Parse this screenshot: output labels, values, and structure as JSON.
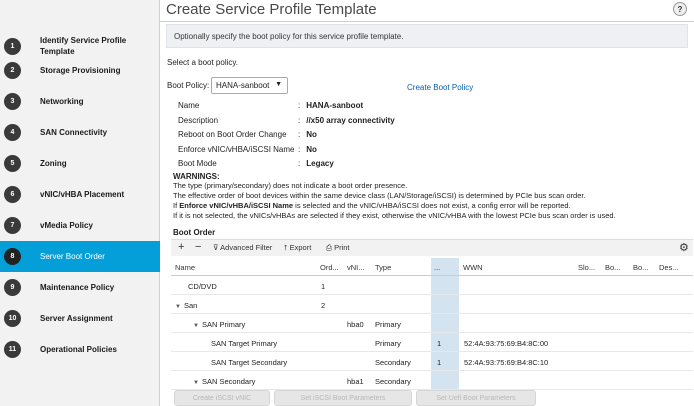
{
  "sidebar": {
    "items": [
      {
        "num": "1",
        "label": "Identify Service Profile Template"
      },
      {
        "num": "2",
        "label": "Storage Provisioning"
      },
      {
        "num": "3",
        "label": "Networking"
      },
      {
        "num": "4",
        "label": "SAN Connectivity"
      },
      {
        "num": "5",
        "label": "Zoning"
      },
      {
        "num": "6",
        "label": "vNIC/vHBA Placement"
      },
      {
        "num": "7",
        "label": "vMedia Policy"
      },
      {
        "num": "8",
        "label": "Server Boot Order"
      },
      {
        "num": "9",
        "label": "Maintenance Policy"
      },
      {
        "num": "10",
        "label": "Server Assignment"
      },
      {
        "num": "11",
        "label": "Operational Policies"
      }
    ],
    "active_index": 7
  },
  "header": {
    "title": "Create Service Profile Template",
    "help": "?"
  },
  "description": "Optionally specify the boot policy for this service profile template.",
  "select_text": "Select a boot policy.",
  "boot_policy": {
    "label": "Boot Policy:",
    "value": "HANA-sanboot",
    "create_link": "Create Boot Policy"
  },
  "properties": [
    {
      "name": "Name",
      "value": "HANA-sanboot"
    },
    {
      "name": "Description",
      "value": "//x50 array connectivity"
    },
    {
      "name": "Reboot on Boot Order Change",
      "value": "No"
    },
    {
      "name": "Enforce vNIC/vHBA/iSCSI Name",
      "value": "No"
    },
    {
      "name": "Boot Mode",
      "value": "Legacy"
    }
  ],
  "warnings": {
    "title": "WARNINGS:",
    "line1": "The type (primary/secondary) does not indicate a boot order presence.",
    "line2": "The effective order of boot devices within the same device class (LAN/Storage/iSCSI) is determined by PCIe bus scan order.",
    "line3_prefix": "If ",
    "line3_bold": "Enforce vNIC/vHBA/iSCSI Name",
    "line3_suffix": " is selected and the vNIC/vHBA/iSCSI does not exist, a config error will be reported.",
    "line4": "If it is not selected, the vNICs/vHBAs are selected if they exist, otherwise the vNIC/vHBA with the lowest PCIe bus scan order is used."
  },
  "boot_order": {
    "title": "Boot Order",
    "toolbar": {
      "add": "+",
      "remove": "−",
      "filter": "Advanced Filter",
      "export": "Export",
      "print": "Print"
    },
    "columns": [
      "Name",
      "Ord...",
      "vNI...",
      "Type",
      "...",
      "WWN",
      "Slo...",
      "Bo...",
      "Bo...",
      "Des..."
    ],
    "rows": [
      {
        "name": "CD/DVD",
        "ord": "1",
        "vnic": "",
        "type": "",
        "lun": "",
        "wwn": "",
        "expand": ""
      },
      {
        "name": "San",
        "ord": "2",
        "vnic": "",
        "type": "",
        "lun": "",
        "wwn": "",
        "expand": "▼"
      },
      {
        "name": "SAN Primary",
        "ord": "",
        "vnic": "hba0",
        "type": "Primary",
        "lun": "",
        "wwn": "",
        "expand": "▼"
      },
      {
        "name": "SAN Target Primary",
        "ord": "",
        "vnic": "",
        "type": "Primary",
        "lun": "1",
        "wwn": "52:4A:93:75:69:B4:8C:00",
        "expand": ""
      },
      {
        "name": "SAN Target Secondary",
        "ord": "",
        "vnic": "",
        "type": "Secondary",
        "lun": "1",
        "wwn": "52:4A:93:75:69:B4:8C:10",
        "expand": ""
      },
      {
        "name": "SAN Secondary",
        "ord": "",
        "vnic": "hba1",
        "type": "Secondary",
        "lun": "",
        "wwn": "",
        "expand": "▼"
      }
    ]
  },
  "footer_buttons": [
    "Create iSCSI vNIC",
    "Set iSCSI Boot Parameters",
    "Set Uefi Boot Parameters"
  ]
}
